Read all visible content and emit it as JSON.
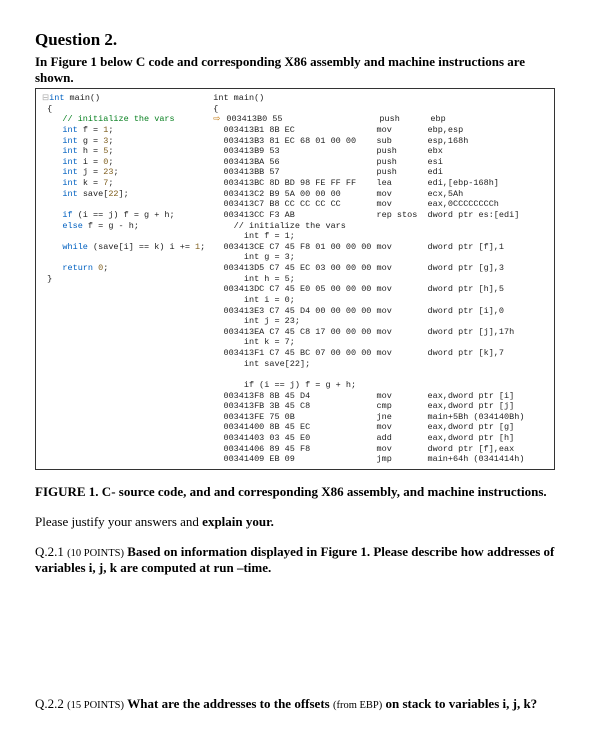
{
  "title": "Question 2.",
  "intro": "In Figure 1 below C code and corresponding X86 assembly and machine instructions are shown.",
  "c_code": {
    "sig": "int main()",
    "open": "{",
    "comment": "// initialize the vars",
    "lines": [
      "int f = 1;",
      "int g = 3;",
      "int h = 5;",
      "int i = 0;",
      "int j = 23;",
      "int k = 7;",
      "int save[22];",
      "",
      "if (i == j) f = g + h;",
      "else f = g - h;",
      "",
      "while (save[i] == k) i += 1;",
      "",
      "return 0;"
    ],
    "close": "}"
  },
  "asm_header": "int main()",
  "asm_open": "{",
  "asm": [
    {
      "addr": "003413B0",
      "bytes": "55",
      "op": "push",
      "args": "ebp",
      "arrow": true
    },
    {
      "addr": "003413B1",
      "bytes": "8B EC",
      "op": "mov",
      "args": "ebp,esp"
    },
    {
      "addr": "003413B3",
      "bytes": "81 EC 68 01 00 00",
      "op": "sub",
      "args": "esp,168h"
    },
    {
      "addr": "003413B9",
      "bytes": "53",
      "op": "push",
      "args": "ebx"
    },
    {
      "addr": "003413BA",
      "bytes": "56",
      "op": "push",
      "args": "esi"
    },
    {
      "addr": "003413BB",
      "bytes": "57",
      "op": "push",
      "args": "edi"
    },
    {
      "addr": "003413BC",
      "bytes": "8D BD 98 FE FF FF",
      "op": "lea",
      "args": "edi,[ebp-168h]"
    },
    {
      "addr": "003413C2",
      "bytes": "B9 5A 00 00 00",
      "op": "mov",
      "args": "ecx,5Ah"
    },
    {
      "addr": "003413C7",
      "bytes": "B8 CC CC CC CC",
      "op": "mov",
      "args": "eax,0CCCCCCCCh"
    },
    {
      "addr": "003413CC",
      "bytes": "F3 AB",
      "op": "rep stos",
      "args": "dword ptr es:[edi]"
    }
  ],
  "asm_comments": [
    {
      "text": "// initialize the vars"
    },
    {
      "text": "  int f = 1;"
    }
  ],
  "asm2": [
    {
      "addr": "003413CE",
      "bytes": "C7 45 F8 01 00 00 00",
      "op": "mov",
      "args": "dword ptr [f],1"
    },
    {
      "src": "  int g = 3;"
    },
    {
      "addr": "003413D5",
      "bytes": "C7 45 EC 03 00 00 00",
      "op": "mov",
      "args": "dword ptr [g],3"
    },
    {
      "src": "  int h = 5;"
    },
    {
      "addr": "003413DC",
      "bytes": "C7 45 E0 05 00 00 00",
      "op": "mov",
      "args": "dword ptr [h],5"
    },
    {
      "src": "  int i = 0;"
    },
    {
      "addr": "003413E3",
      "bytes": "C7 45 D4 00 00 00 00",
      "op": "mov",
      "args": "dword ptr [i],0"
    },
    {
      "src": "  int j = 23;"
    },
    {
      "addr": "003413EA",
      "bytes": "C7 45 C8 17 00 00 00",
      "op": "mov",
      "args": "dword ptr [j],17h"
    },
    {
      "src": "  int k = 7;"
    },
    {
      "addr": "003413F1",
      "bytes": "C7 45 BC 07 00 00 00",
      "op": "mov",
      "args": "dword ptr [k],7"
    },
    {
      "src": "  int save[22];"
    },
    {
      "src": ""
    },
    {
      "src": "  if (i == j) f = g + h;"
    },
    {
      "addr": "003413F8",
      "bytes": "8B 45 D4",
      "op": "mov",
      "args": "eax,dword ptr [i]"
    },
    {
      "addr": "003413FB",
      "bytes": "3B 45 C8",
      "op": "cmp",
      "args": "eax,dword ptr [j]"
    },
    {
      "addr": "003413FE",
      "bytes": "75 0B",
      "op": "jne",
      "args": "main+5Bh (034140Bh)"
    },
    {
      "addr": "00341400",
      "bytes": "8B 45 EC",
      "op": "mov",
      "args": "eax,dword ptr [g]"
    },
    {
      "addr": "00341403",
      "bytes": "03 45 E0",
      "op": "add",
      "args": "eax,dword ptr [h]"
    },
    {
      "addr": "00341406",
      "bytes": "89 45 F8",
      "op": "mov",
      "args": "dword ptr [f],eax"
    },
    {
      "addr": "00341409",
      "bytes": "EB 09",
      "op": "jmp",
      "args": "main+64h (0341414h)"
    }
  ],
  "caption": "FIGURE 1.  C- source code, and and corresponding X86 assembly, and machine instructions.",
  "justify": "Please justify your answers and explain your.",
  "q21_label": "Q.2.1 (10 POINTS)",
  "q21_text": "Based on information displayed in Figure 1. Please describe how addresses of variables i, j, k are computed at run –time.",
  "q22_label": "Q.2.2 (15 POINTS)",
  "q22_text": "What are the addresses to the offsets (from EBP) on stack to variables i, j, k?",
  "q22_from": "(from EBP)"
}
